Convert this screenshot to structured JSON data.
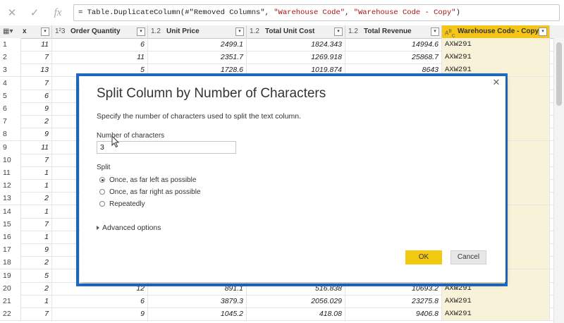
{
  "formula_bar": {
    "cancel_icon": "close-icon",
    "confirm_icon": "check-icon",
    "fx_label": "fx",
    "formula_prefix": "= Table.DuplicateColumn(#\"Removed Columns\", ",
    "formula_arg1": "\"Warehouse Code\"",
    "formula_sep": ", ",
    "formula_arg2": "\"Warehouse Code - Copy\"",
    "formula_suffix": ")"
  },
  "table": {
    "columns": [
      {
        "type": "",
        "label": "x"
      },
      {
        "type": "1²3",
        "label": "Order Quantity"
      },
      {
        "type": "1.2",
        "label": "Unit Price"
      },
      {
        "type": "1.2",
        "label": "Total Unit Cost"
      },
      {
        "type": "1.2",
        "label": "Total Revenue"
      },
      {
        "type": "A^B_C",
        "label": "Warehouse Code - Copy"
      }
    ],
    "rows": [
      [
        "1",
        "11",
        "6",
        "2499.1",
        "1824.343",
        "14994.6",
        "AXW291"
      ],
      [
        "2",
        "7",
        "11",
        "2351.7",
        "1269.918",
        "25868.7",
        "AXW291"
      ],
      [
        "3",
        "13",
        "5",
        "1728.6",
        "1019.874",
        "8643",
        "AXW291"
      ],
      [
        "4",
        "7",
        "",
        "",
        "",
        "",
        ""
      ],
      [
        "5",
        "6",
        "",
        "",
        "",
        "",
        ""
      ],
      [
        "6",
        "9",
        "",
        "",
        "",
        "",
        ""
      ],
      [
        "7",
        "2",
        "",
        "",
        "",
        "",
        ""
      ],
      [
        "8",
        "9",
        "",
        "",
        "",
        "",
        ""
      ],
      [
        "9",
        "11",
        "",
        "",
        "",
        "",
        ""
      ],
      [
        "10",
        "7",
        "",
        "",
        "",
        "",
        ""
      ],
      [
        "11",
        "1",
        "",
        "",
        "",
        "",
        ""
      ],
      [
        "12",
        "1",
        "",
        "",
        "",
        "",
        ""
      ],
      [
        "13",
        "2",
        "",
        "",
        "",
        "",
        ""
      ],
      [
        "14",
        "1",
        "",
        "",
        "",
        "",
        ""
      ],
      [
        "15",
        "7",
        "",
        "",
        "",
        "",
        ""
      ],
      [
        "16",
        "1",
        "",
        "",
        "",
        "",
        ""
      ],
      [
        "17",
        "9",
        "",
        "",
        "",
        "",
        ""
      ],
      [
        "18",
        "2",
        "",
        "",
        "",
        "",
        ""
      ],
      [
        "19",
        "5",
        "",
        "",
        "",
        "",
        ""
      ],
      [
        "20",
        "2",
        "12",
        "891.1",
        "516.838",
        "10693.2",
        "AXW291"
      ],
      [
        "21",
        "1",
        "6",
        "3879.3",
        "2056.029",
        "23275.8",
        "AXW291"
      ],
      [
        "22",
        "7",
        "9",
        "1045.2",
        "418.08",
        "9406.8",
        "AXW291"
      ]
    ]
  },
  "dialog": {
    "title": "Split Column by Number of Characters",
    "subtitle": "Specify the number of characters used to split the text column.",
    "num_label": "Number of characters",
    "num_value": "3",
    "split_label": "Split",
    "options": [
      {
        "label": "Once, as far left as possible",
        "selected": true
      },
      {
        "label": "Once, as far right as possible",
        "selected": false
      },
      {
        "label": "Repeatedly",
        "selected": false
      }
    ],
    "advanced_label": "Advanced options",
    "ok_label": "OK",
    "cancel_label": "Cancel"
  },
  "colors": {
    "accent_yellow": "#f2c811",
    "frame_blue": "#1f6ec6"
  }
}
